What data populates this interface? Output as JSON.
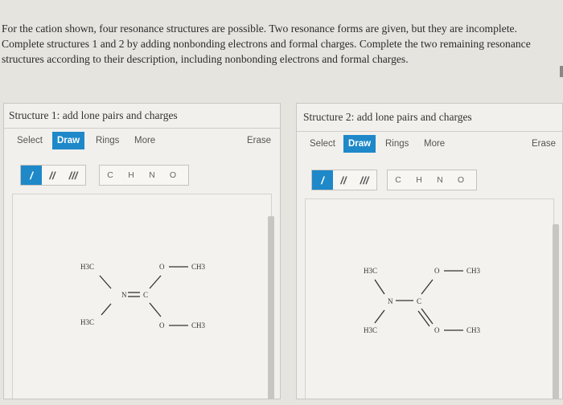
{
  "question": {
    "lines": [
      "For the cation shown, four resonance structures are possible. Two resonance forms are given, but they are incomplete.",
      "Complete structures 1 and 2 by adding nonbonding electrons and formal charges. Complete the two remaining resonance",
      "structures according to their description, including nonbonding electrons and formal charges."
    ]
  },
  "panels": [
    {
      "title": "Structure 1: add lone pairs and charges",
      "tools": {
        "select": "Select",
        "draw": "Draw",
        "rings": "Rings",
        "more": "More",
        "erase": "Erase"
      },
      "bonds": [
        "/",
        "//",
        "///"
      ],
      "atoms": [
        "C",
        "H",
        "N",
        "O"
      ],
      "molecule": {
        "h3c_top": "H3C",
        "h3c_bottom": "H3C",
        "n": "N",
        "c": "C",
        "o_top": "O",
        "ch3_top": "CH3",
        "o_bottom": "O",
        "ch3_bottom": "CH3"
      }
    },
    {
      "title": "Structure 2: add lone pairs and charges",
      "tools": {
        "select": "Select",
        "draw": "Draw",
        "rings": "Rings",
        "more": "More",
        "erase": "Erase"
      },
      "bonds": [
        "/",
        "//",
        "///"
      ],
      "atoms": [
        "C",
        "H",
        "N",
        "O"
      ],
      "molecule": {
        "h3c_top": "H3C",
        "h3c_bottom": "H3C",
        "n": "N",
        "c": "C",
        "o_top": "O",
        "ch3_top": "CH3",
        "o_bottom": "O",
        "ch3_bottom": "CH3"
      }
    }
  ]
}
